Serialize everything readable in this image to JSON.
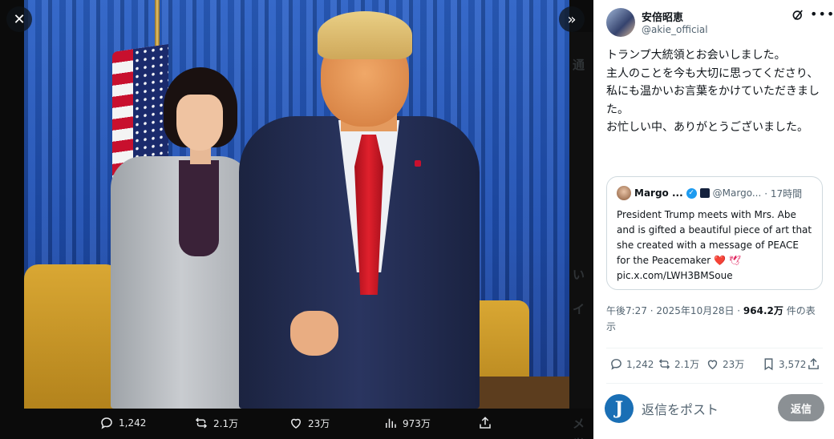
{
  "viewer": {
    "stats": {
      "replies": "1,242",
      "reposts": "2.1万",
      "likes": "23万",
      "views": "973万"
    }
  },
  "side_strip": [
    "通",
    "い",
    "イ",
    "メッ"
  ],
  "tweet": {
    "author": {
      "name": "安倍昭恵",
      "handle": "@akie_official"
    },
    "text": "トランプ大統領とお会いしました。\n主人のことを今も大切に思ってくださり、私にも温かいお言葉をかけていただきました。\nお忙しい中、ありがとうございました。",
    "quote": {
      "name": "Margo ...",
      "handle": "@Margo...",
      "time": "· 17時間",
      "text": "President Trump meets with Mrs. Abe and is gifted a beautiful piece of art that she created with a message of PEACE for the Peacemaker",
      "emojis": "❤️ 🕊",
      "link": "pic.x.com/LWH3BMSoue"
    },
    "meta": {
      "time_date": "午後7:27 · 2025年10月28日 · ",
      "views": "964.2万",
      "views_suffix": " 件の表示"
    },
    "stats": {
      "replies": "1,242",
      "reposts": "2.1万",
      "likes": "23万",
      "bookmarks": "3,572"
    }
  },
  "reply": {
    "avatar_letter": "J",
    "placeholder": "返信をポスト",
    "button": "返信"
  },
  "colors": {
    "accent": "#1d9bf0",
    "panel_bg": "#ffffff",
    "viewer_bg": "#0b0b0b",
    "reply_button": "#8b9094"
  }
}
